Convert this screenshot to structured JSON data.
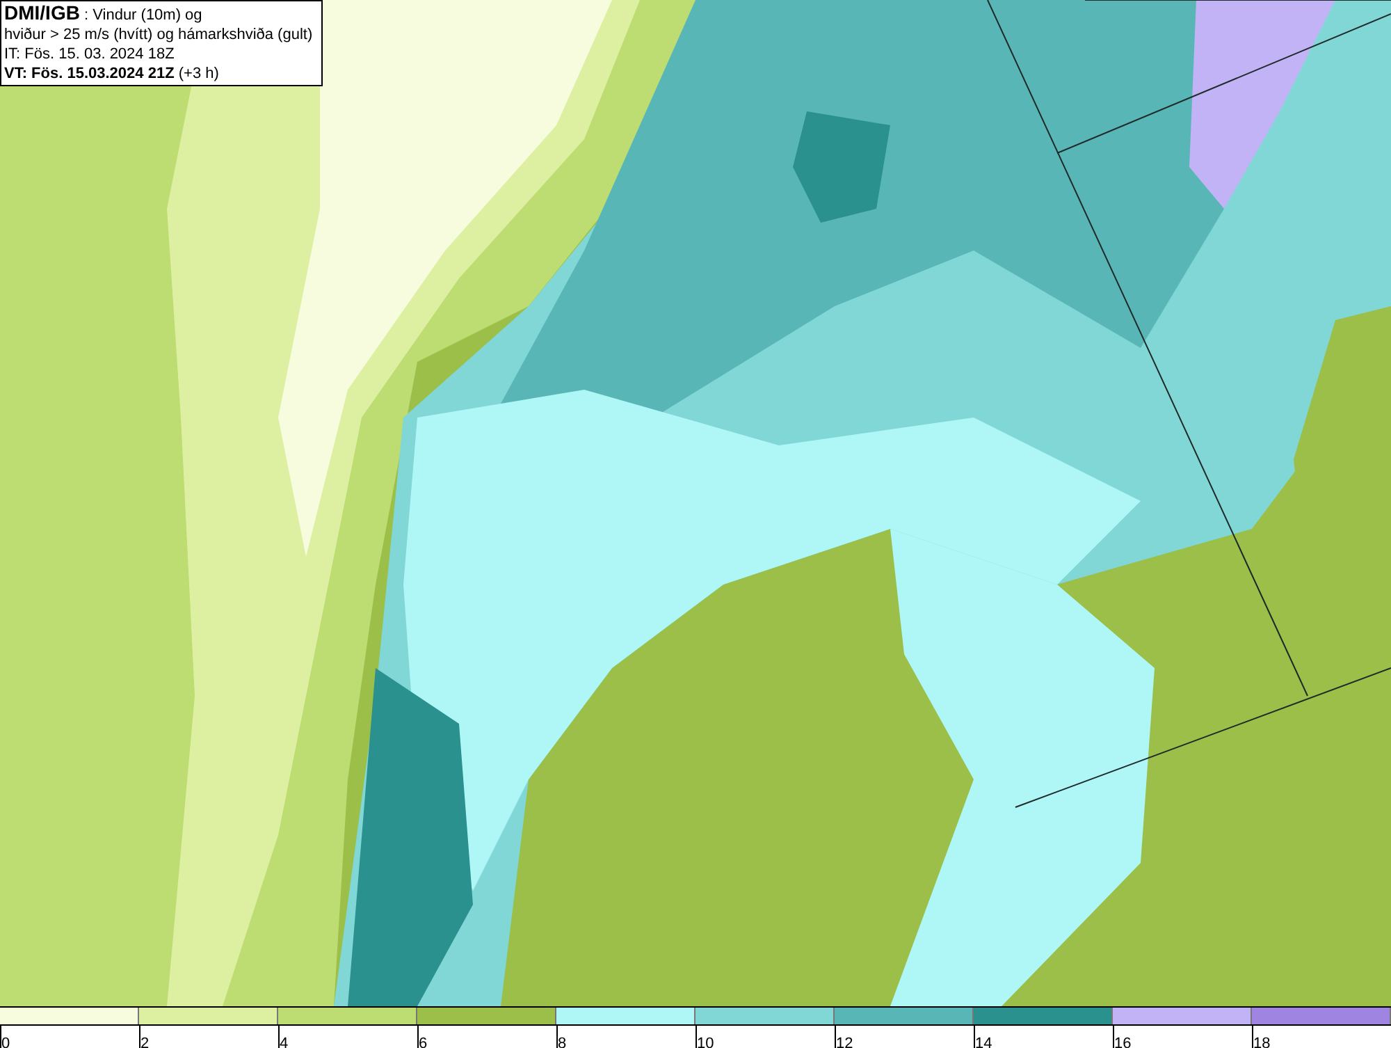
{
  "title_box": {
    "source": "DMI/IGB",
    "lines": [
      " : Vindur (10m) og",
      "hviður > 25 m/s (hvítt) og hámarkshviða (gult)",
      "IT: Fös. 15. 03. 2024 18Z"
    ],
    "valid_time": "VT: Fös. 15.03.2024 21Z",
    "offset": " (+3 h)"
  },
  "legend": {
    "bins": [
      {
        "label": "0",
        "color": "#f7fcdf"
      },
      {
        "label": "2",
        "color": "#ddf0a2"
      },
      {
        "label": "4",
        "color": "#bddc72"
      },
      {
        "label": "6",
        "color": "#9bbf48"
      },
      {
        "label": "8",
        "color": "#aef7f6"
      },
      {
        "label": "10",
        "color": "#80d7d6"
      },
      {
        "label": "12",
        "color": "#58b7b6"
      },
      {
        "label": "14",
        "color": "#2b918f"
      },
      {
        "label": "16",
        "color": "#c2b3f7"
      },
      {
        "label": "18",
        "color": "#9f84e2"
      }
    ]
  }
}
